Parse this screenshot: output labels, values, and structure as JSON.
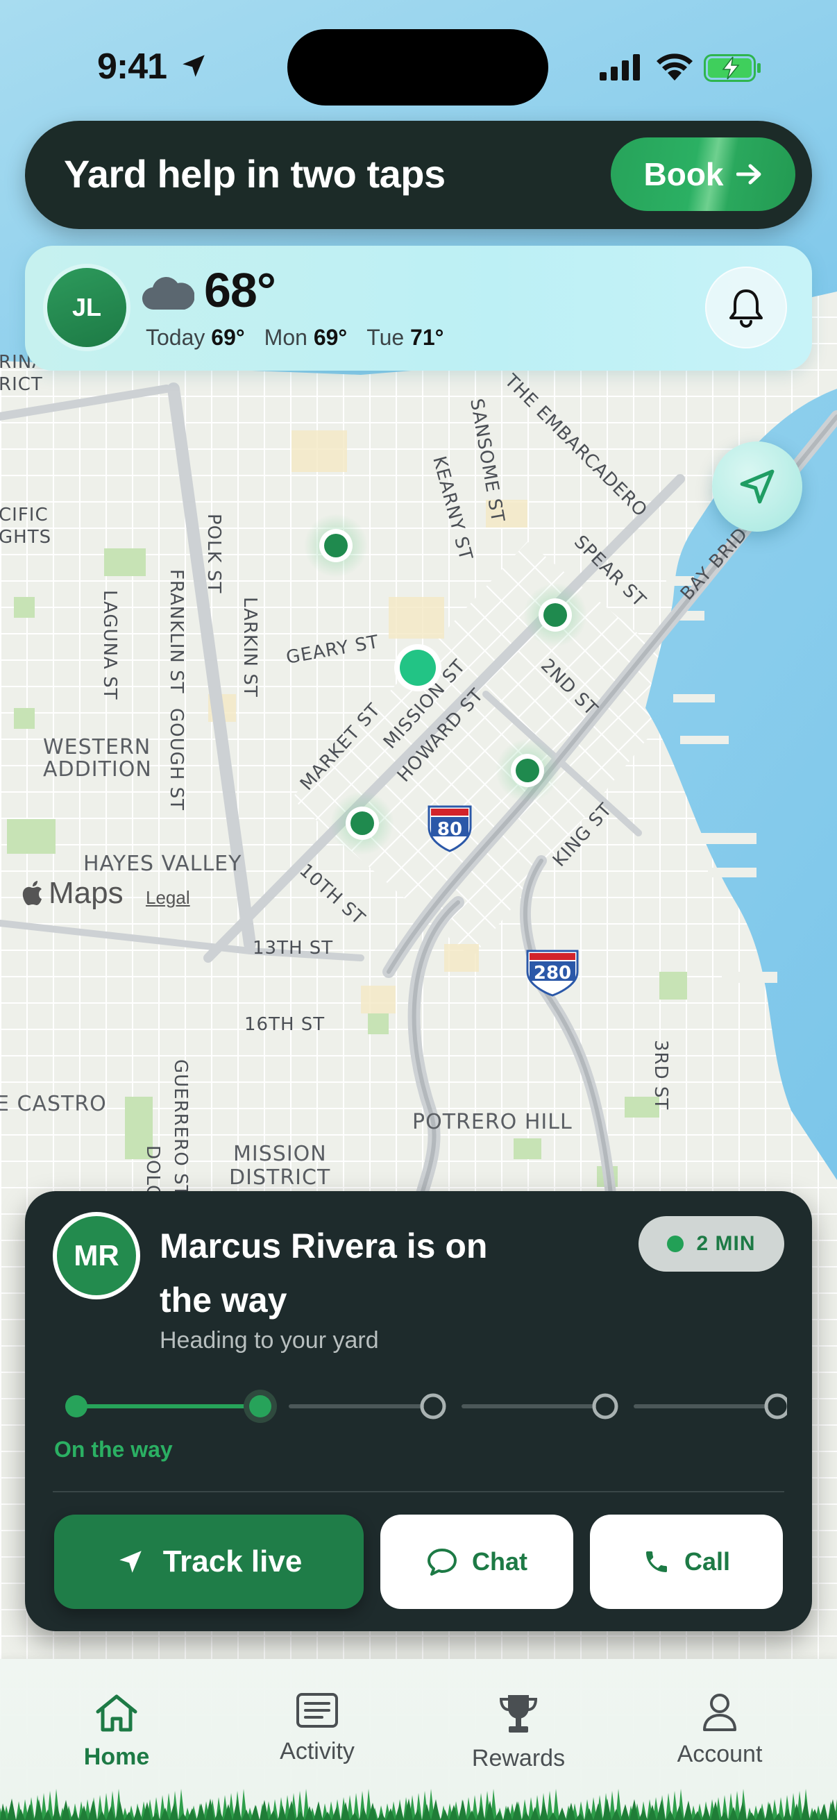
{
  "status_bar": {
    "time": "9:41"
  },
  "promo": {
    "title": "Yard help in two taps",
    "button_label": "Book",
    "button_color": "#27a35a"
  },
  "weather": {
    "avatar_initials": "JL",
    "current_temp": "68°",
    "forecast": [
      {
        "day": "Today",
        "temp": "69°"
      },
      {
        "day": "Mon",
        "temp": "69°"
      },
      {
        "day": "Tue",
        "temp": "71°"
      }
    ]
  },
  "map": {
    "labels": {
      "marina_district": "RINA\nRICT",
      "pacific_heights": "CIFIC\nGHTS",
      "western_addition": "WESTERN\nADDITION",
      "hayes_valley": "HAYES VALLEY",
      "castro": "E CASTRO",
      "mission_district": "MISSION\nDISTRICT",
      "potrero_hill": "POTRERO HILL",
      "polk": "POLK ST",
      "franklin": "FRANKLIN ST",
      "larkin": "LARKIN ST",
      "laguna": "LAGUNA ST",
      "gough": "GOUGH ST",
      "geary": "GEARY ST",
      "market": "MARKET ST",
      "mission": "MISSION ST",
      "howard": "HOWARD ST",
      "kearny": "KEARNY ST",
      "sansome": "SANSOME ST",
      "embarcadero": "THE EMBARCADERO",
      "spear": "SPEAR ST",
      "second": "2ND ST",
      "king": "KING ST",
      "bay_bridge": "BAY BRID",
      "tenth": "10TH ST",
      "thirteenth": "13TH ST",
      "sixteenth": "16TH ST",
      "guerrero": "GUERRERO ST",
      "dolores": "DOLO",
      "third": "3RD ST",
      "i80": "80",
      "i280": "280"
    },
    "attribution": "Maps",
    "legal": "Legal"
  },
  "eta_card": {
    "avatar_initials": "MR",
    "title": "Marcus Rivera is on the way",
    "subtitle": "Heading to your yard",
    "eta": "2 MIN",
    "status": "On the way",
    "progress_step": 2,
    "progress_steps": 6,
    "actions": {
      "track": "Track live",
      "chat": "Chat",
      "call": "Call"
    },
    "accent": "#1f7d48"
  },
  "tabs": [
    {
      "label": "Home",
      "icon": "home-icon",
      "active": true
    },
    {
      "label": "Activity",
      "icon": "activity-icon",
      "active": false
    },
    {
      "label": "Rewards",
      "icon": "trophy-icon",
      "active": false
    },
    {
      "label": "Account",
      "icon": "person-icon",
      "active": false
    }
  ]
}
